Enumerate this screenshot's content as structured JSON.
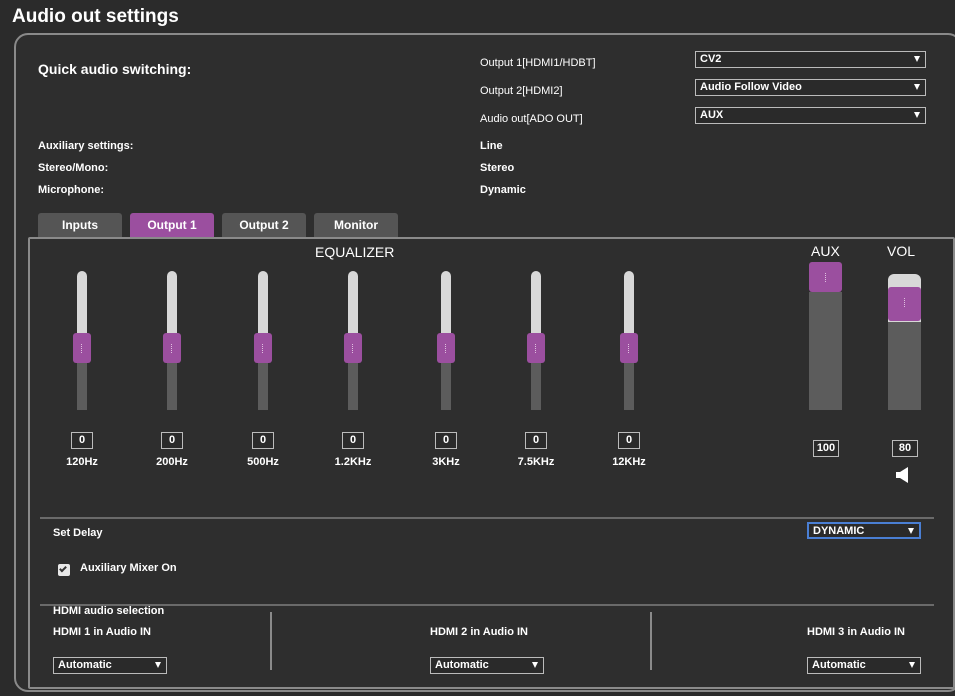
{
  "title": "Audio out settings",
  "quick": {
    "heading": "Quick audio switching:"
  },
  "outputs": [
    {
      "label": "Output 1[HDMI1/HDBT]",
      "value": "CV2"
    },
    {
      "label": "Output 2[HDMI2]",
      "value": "Audio Follow Video"
    },
    {
      "label": "Audio out[ADO OUT]",
      "value": "AUX"
    }
  ],
  "settings": [
    {
      "label": "Auxiliary settings:",
      "value": "Line"
    },
    {
      "label": "Stereo/Mono:",
      "value": "Stereo"
    },
    {
      "label": "Microphone:",
      "value": "Dynamic"
    }
  ],
  "tabs": [
    {
      "label": "Inputs",
      "active": false
    },
    {
      "label": "Output 1",
      "active": true
    },
    {
      "label": "Output 2",
      "active": false
    },
    {
      "label": "Monitor",
      "active": false
    }
  ],
  "equalizer": {
    "title": "EQUALIZER",
    "bands": [
      {
        "freq": "120Hz",
        "value": "0"
      },
      {
        "freq": "200Hz",
        "value": "0"
      },
      {
        "freq": "500Hz",
        "value": "0"
      },
      {
        "freq": "1.2KHz",
        "value": "0"
      },
      {
        "freq": "3KHz",
        "value": "0"
      },
      {
        "freq": "7.5KHz",
        "value": "0"
      },
      {
        "freq": "12KHz",
        "value": "0"
      }
    ]
  },
  "aux": {
    "label": "AUX",
    "value": "100"
  },
  "vol": {
    "label": "VOL",
    "value": "80",
    "icon": "speaker-icon"
  },
  "delay": {
    "label": "Set Delay",
    "value": "DYNAMIC"
  },
  "mixer": {
    "label": "Auxiliary Mixer On",
    "checked": true
  },
  "hdmi": {
    "heading": "HDMI audio selection",
    "items": [
      {
        "label": "HDMI 1 in Audio IN",
        "value": "Automatic"
      },
      {
        "label": "HDMI 2 in Audio IN",
        "value": "Automatic"
      },
      {
        "label": "HDMI 3 in Audio IN",
        "value": "Automatic"
      }
    ]
  },
  "colors": {
    "accent": "#9b4f9f",
    "background": "#2b2b2b"
  }
}
